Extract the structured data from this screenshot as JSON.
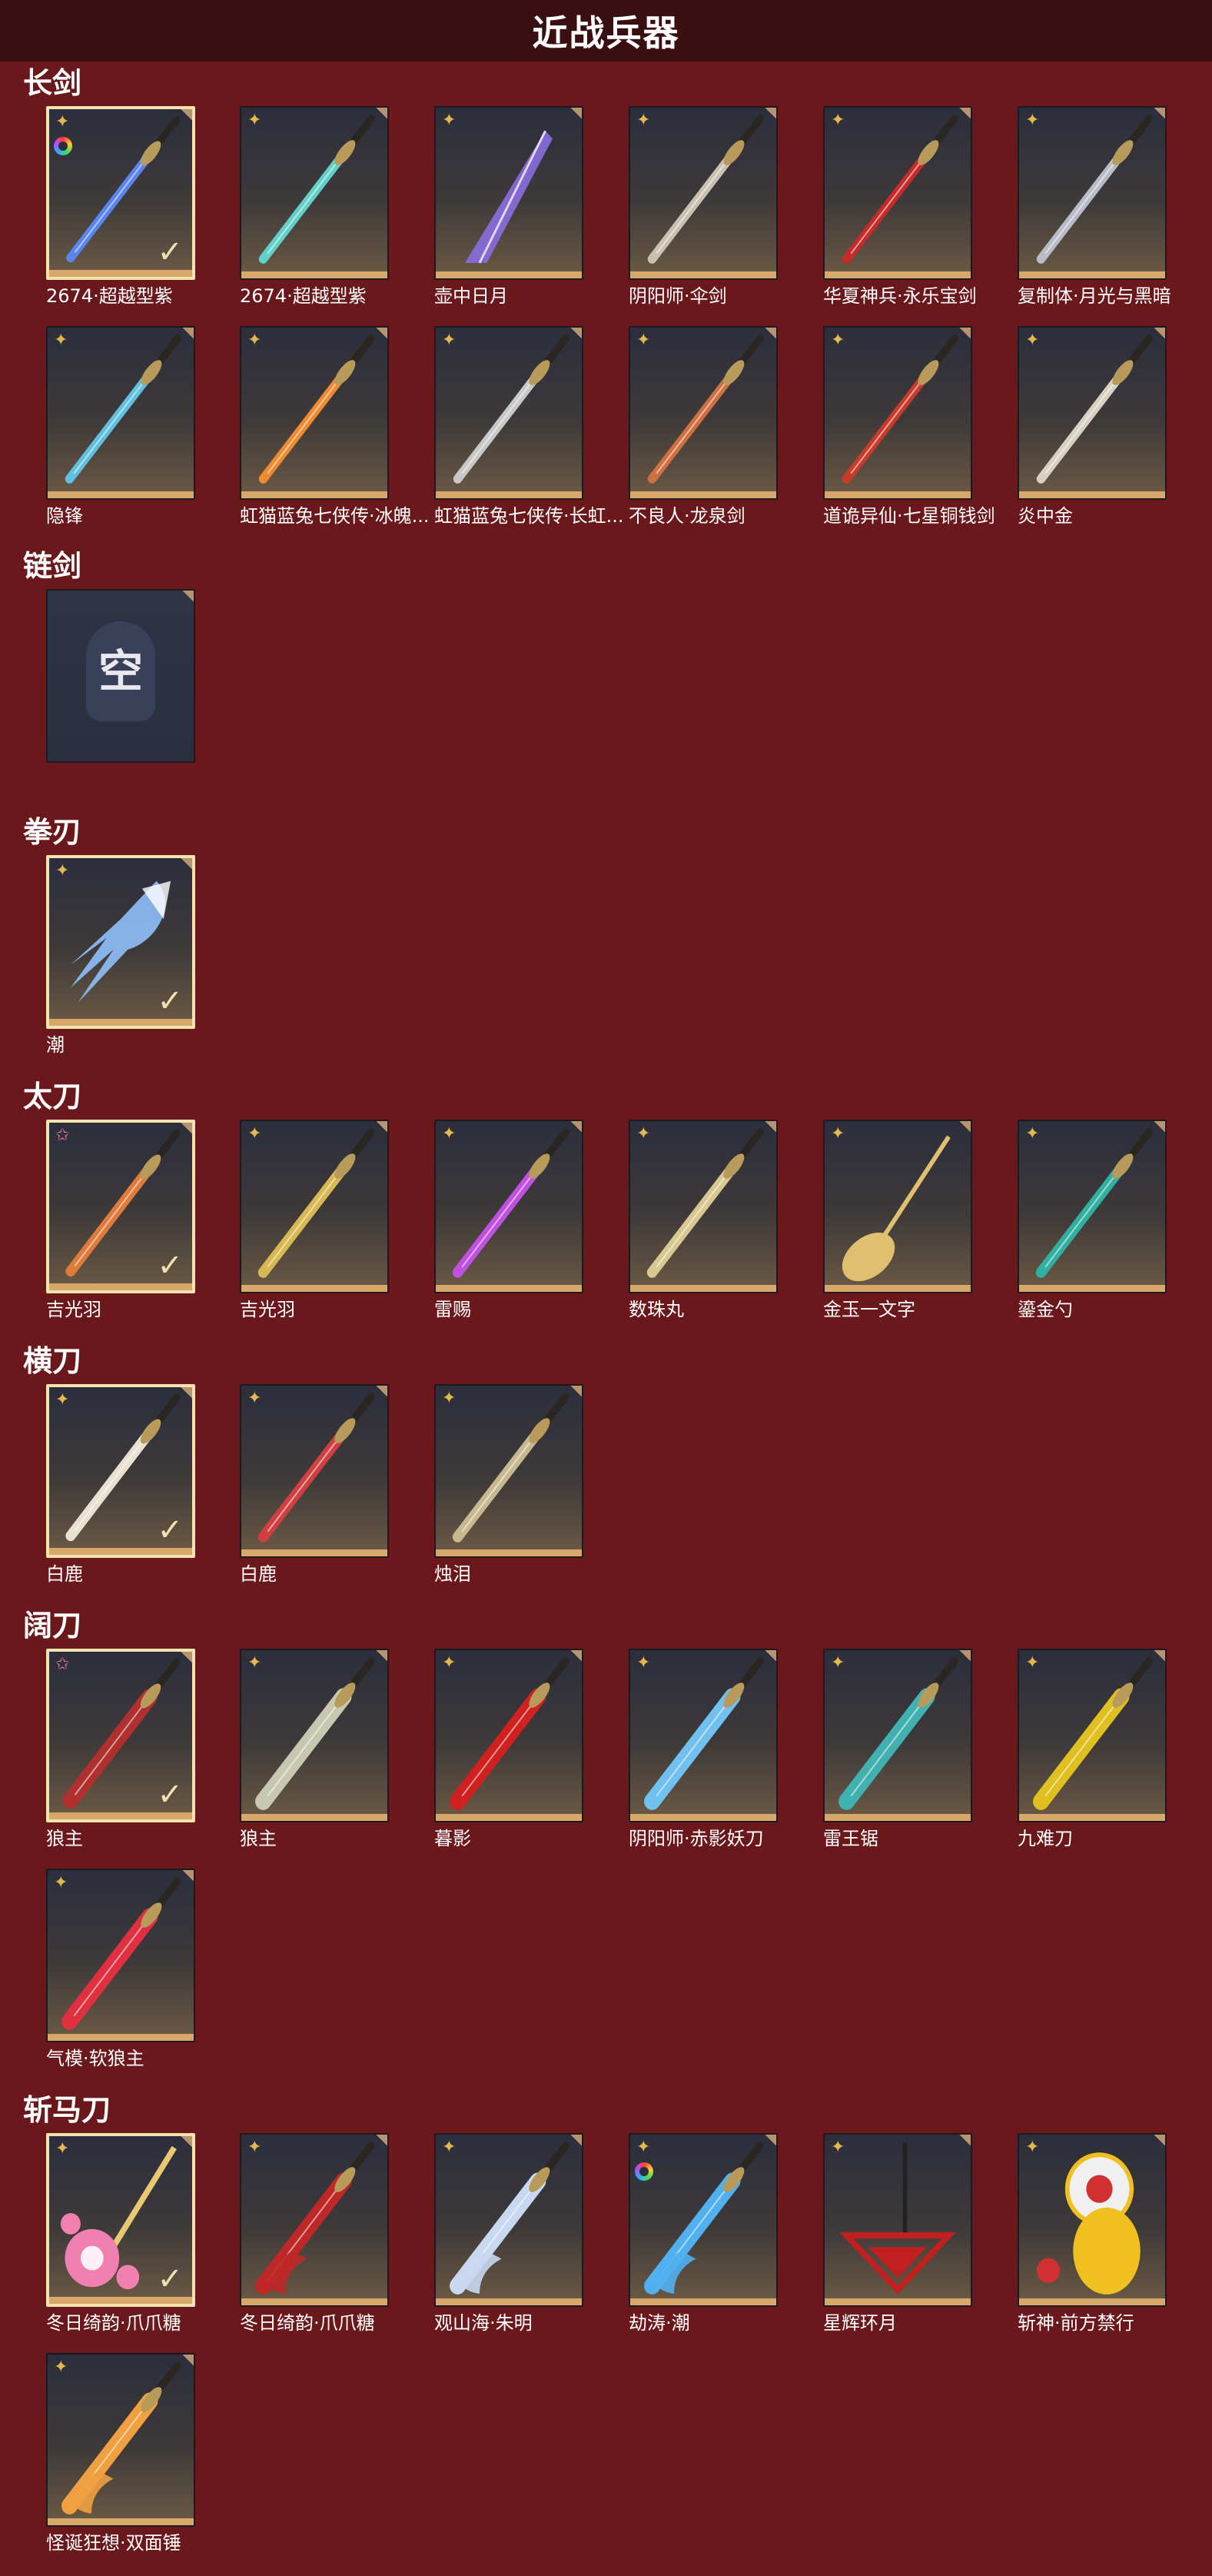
{
  "page": {
    "title": "近战兵器"
  },
  "colors": {
    "background": "#6a181c",
    "header": "#3a0f12",
    "gold_tag": "#e5b84e",
    "pink_tag": "#e87a8e",
    "card_bottom": "#d8a86a",
    "selected_border": "#f2e3b0"
  },
  "categories": [
    {
      "title": "长剑",
      "items": [
        {
          "label": "2674·超越型紫",
          "tag": "gold",
          "selected": true,
          "rainbow": true,
          "art": {
            "color": "#5a84f0",
            "kind": "sword"
          }
        },
        {
          "label": "2674·超越型紫",
          "tag": "gold",
          "selected": false,
          "rainbow": false,
          "art": {
            "color": "#62d0c8",
            "kind": "sword"
          }
        },
        {
          "label": "壶中日月",
          "tag": "gold",
          "selected": false,
          "rainbow": false,
          "art": {
            "color": "#8a6ee0",
            "kind": "umbrella"
          }
        },
        {
          "label": "阴阳师·伞剑",
          "tag": "gold",
          "selected": false,
          "rainbow": false,
          "art": {
            "color": "#c9c0b0",
            "kind": "sword"
          }
        },
        {
          "label": "华夏神兵·永乐宝剑",
          "tag": "gold",
          "selected": false,
          "rainbow": false,
          "art": {
            "color": "#c82a2a",
            "kind": "sword"
          }
        },
        {
          "label": "复制体·月光与黑暗",
          "tag": "gold",
          "selected": false,
          "rainbow": false,
          "art": {
            "color": "#b8bcc8",
            "kind": "sword"
          }
        },
        {
          "label": "隐锋",
          "tag": "gold",
          "selected": false,
          "rainbow": false,
          "art": {
            "color": "#5fc0e0",
            "kind": "sword"
          }
        },
        {
          "label": "虹猫蓝兔七侠传·冰魄...",
          "tag": "gold",
          "selected": false,
          "rainbow": false,
          "art": {
            "color": "#f08a30",
            "kind": "sword"
          }
        },
        {
          "label": "虹猫蓝兔七侠传·长虹...",
          "tag": "gold",
          "selected": false,
          "rainbow": false,
          "art": {
            "color": "#c8c8c8",
            "kind": "sword"
          }
        },
        {
          "label": "不良人·龙泉剑",
          "tag": "gold",
          "selected": false,
          "rainbow": false,
          "art": {
            "color": "#d07040",
            "kind": "sword"
          }
        },
        {
          "label": "道诡异仙·七星铜钱剑",
          "tag": "gold",
          "selected": false,
          "rainbow": false,
          "art": {
            "color": "#c83a2a",
            "kind": "sword"
          }
        },
        {
          "label": "炎中金",
          "tag": "gold",
          "selected": false,
          "rainbow": false,
          "art": {
            "color": "#d8d0c0",
            "kind": "sword"
          }
        }
      ]
    },
    {
      "title": "链剑",
      "items": [
        {
          "label": "",
          "tag": "none",
          "selected": false,
          "rainbow": false,
          "empty": true,
          "empty_text": "空",
          "art": {
            "color": "#39415a",
            "kind": "empty"
          }
        }
      ]
    },
    {
      "title": "拳刃",
      "items": [
        {
          "label": "潮",
          "tag": "gold",
          "selected": true,
          "rainbow": false,
          "art": {
            "color": "#8ab8f0",
            "kind": "claw"
          }
        }
      ]
    },
    {
      "title": "太刀",
      "items": [
        {
          "label": "吉光羽",
          "tag": "pink",
          "selected": true,
          "rainbow": false,
          "art": {
            "color": "#e07a3a",
            "kind": "blade"
          }
        },
        {
          "label": "吉光羽",
          "tag": "gold",
          "selected": false,
          "rainbow": false,
          "art": {
            "color": "#d8b850",
            "kind": "blade"
          }
        },
        {
          "label": "雷赐",
          "tag": "gold",
          "selected": false,
          "rainbow": false,
          "art": {
            "color": "#c050e0",
            "kind": "blade"
          }
        },
        {
          "label": "数珠丸",
          "tag": "gold",
          "selected": false,
          "rainbow": false,
          "art": {
            "color": "#d8c890",
            "kind": "blade"
          }
        },
        {
          "label": "金玉一文字",
          "tag": "gold",
          "selected": false,
          "rainbow": false,
          "art": {
            "color": "#e0c070",
            "kind": "spoon"
          }
        },
        {
          "label": "鎏金勺",
          "tag": "gold",
          "selected": false,
          "rainbow": false,
          "art": {
            "color": "#30b0a0",
            "kind": "blade"
          }
        }
      ]
    },
    {
      "title": "横刀",
      "items": [
        {
          "label": "白鹿",
          "tag": "gold",
          "selected": true,
          "rainbow": false,
          "art": {
            "color": "#e8e0d0",
            "kind": "blade"
          }
        },
        {
          "label": "白鹿",
          "tag": "gold",
          "selected": false,
          "rainbow": false,
          "art": {
            "color": "#d04040",
            "kind": "blade"
          }
        },
        {
          "label": "烛泪",
          "tag": "gold",
          "selected": false,
          "rainbow": false,
          "art": {
            "color": "#c8b890",
            "kind": "blade"
          }
        }
      ]
    },
    {
      "title": "阔刀",
      "items": [
        {
          "label": "狼主",
          "tag": "pink",
          "selected": true,
          "rainbow": false,
          "art": {
            "color": "#b03030",
            "kind": "broad"
          }
        },
        {
          "label": "狼主",
          "tag": "gold",
          "selected": false,
          "rainbow": false,
          "art": {
            "color": "#c8c8b0",
            "kind": "broad"
          }
        },
        {
          "label": "暮影",
          "tag": "gold",
          "selected": false,
          "rainbow": false,
          "art": {
            "color": "#d02020",
            "kind": "broad"
          }
        },
        {
          "label": "阴阳师·赤影妖刀",
          "tag": "gold",
          "selected": false,
          "rainbow": false,
          "art": {
            "color": "#70c0f0",
            "kind": "broad"
          }
        },
        {
          "label": "雷王锯",
          "tag": "gold",
          "selected": false,
          "rainbow": false,
          "art": {
            "color": "#40b0b0",
            "kind": "broad"
          }
        },
        {
          "label": "九难刀",
          "tag": "gold",
          "selected": false,
          "rainbow": false,
          "art": {
            "color": "#e0c020",
            "kind": "broad"
          }
        },
        {
          "label": "气模·软狼主",
          "tag": "gold",
          "selected": false,
          "rainbow": false,
          "art": {
            "color": "#e03040",
            "kind": "broad"
          }
        }
      ]
    },
    {
      "title": "斩马刀",
      "items": [
        {
          "label": "冬日绮韵·爪爪糖",
          "tag": "gold",
          "selected": true,
          "rainbow": false,
          "art": {
            "color": "#f080b0",
            "kind": "paw"
          }
        },
        {
          "label": "冬日绮韵·爪爪糖",
          "tag": "gold",
          "selected": false,
          "rainbow": false,
          "art": {
            "color": "#c02828",
            "kind": "glaive"
          }
        },
        {
          "label": "观山海·朱明",
          "tag": "gold",
          "selected": false,
          "rainbow": false,
          "art": {
            "color": "#c8d8f0",
            "kind": "glaive"
          }
        },
        {
          "label": "劫涛·潮",
          "tag": "gold",
          "selected": false,
          "rainbow": true,
          "art": {
            "color": "#50b0f0",
            "kind": "glaive"
          }
        },
        {
          "label": "星辉环月",
          "tag": "gold",
          "selected": false,
          "rainbow": false,
          "art": {
            "color": "#c02020",
            "kind": "triangle"
          }
        },
        {
          "label": "斩神·前方禁行",
          "tag": "gold",
          "selected": false,
          "rainbow": false,
          "art": {
            "color": "#f0c020",
            "kind": "sign"
          }
        },
        {
          "label": "怪诞狂想·双面锤",
          "tag": "gold",
          "selected": false,
          "rainbow": false,
          "art": {
            "color": "#f0a040",
            "kind": "glaive"
          }
        }
      ]
    }
  ]
}
